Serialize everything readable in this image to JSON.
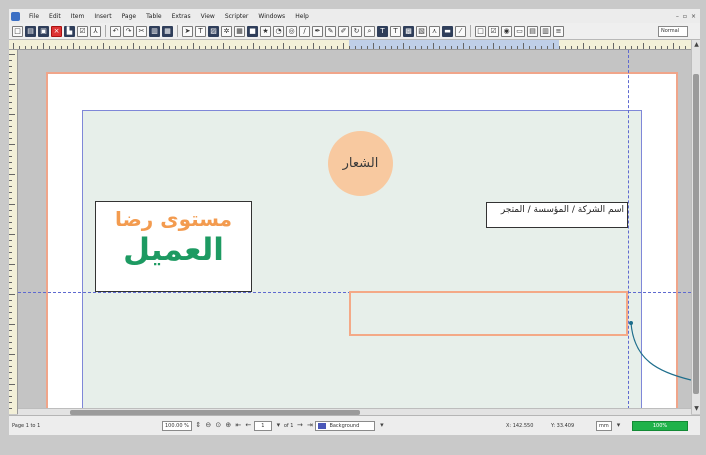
{
  "menubar": {
    "items": [
      "File",
      "Edit",
      "Item",
      "Insert",
      "Page",
      "Table",
      "Extras",
      "View",
      "Scripter",
      "Windows",
      "Help"
    ],
    "window_controls": [
      "–",
      "▫",
      "×"
    ]
  },
  "toolbar": {
    "mode_value": "Normal"
  },
  "document": {
    "logo_text": "الشعار",
    "company_text": "اسم الشركة / المؤسسة / المتجر",
    "satisfaction_line1": "مستوى رضا",
    "satisfaction_line2": "العميل"
  },
  "statusbar": {
    "page_label": "Page 1 to 1",
    "zoom_value": "100.00 %",
    "page_number": "1",
    "page_of": "of 1",
    "layer_name": "Background",
    "x_coord": "X: 142.550",
    "y_coord": "Y: 33.409",
    "unit": "mm",
    "progress_label": "100%",
    "progress": 1.0
  },
  "colors": {
    "accent_orange": "#f39b4f",
    "accent_green": "#1d9a62",
    "logo_fill": "#f8c9a0",
    "guide_blue": "#5f6ad0",
    "margin_orange": "#f0a58a"
  }
}
